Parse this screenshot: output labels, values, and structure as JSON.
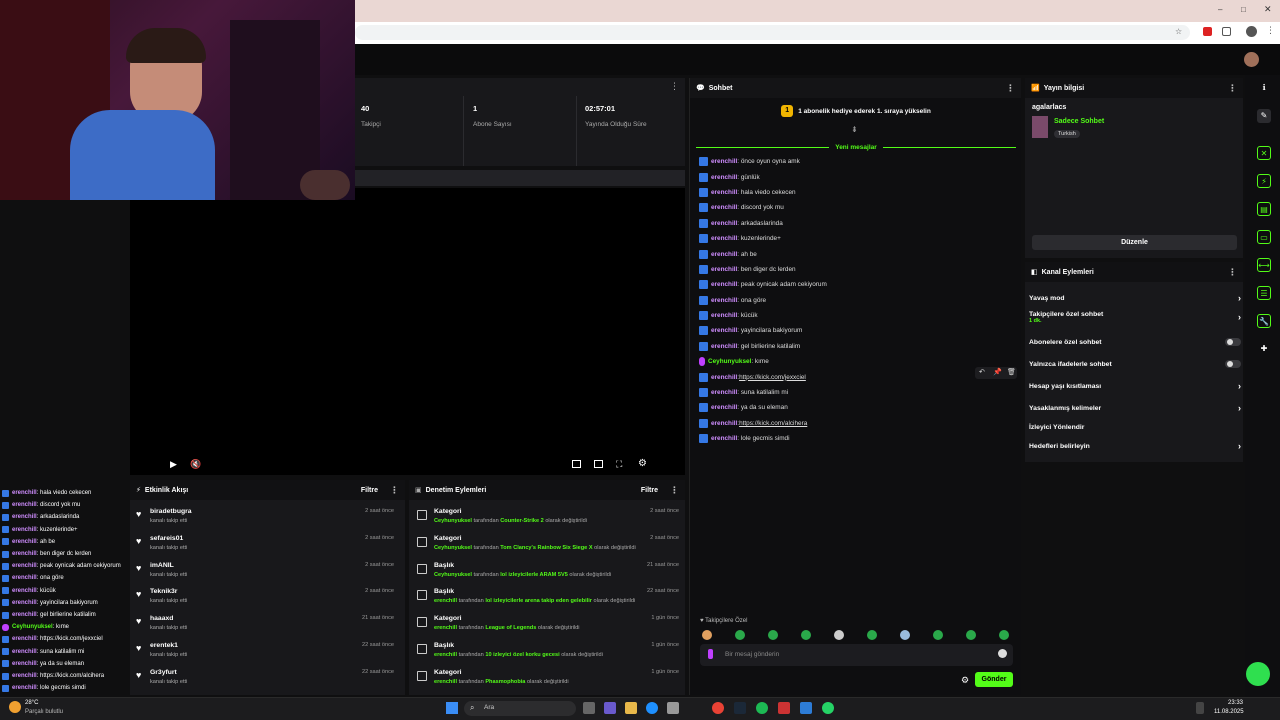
{
  "stats": [
    {
      "value": "40",
      "label": "Takipçi"
    },
    {
      "value": "1",
      "label": "Abone Sayısı"
    },
    {
      "value": "02:57:01",
      "label": "Yayında Olduğu Süre"
    }
  ],
  "activity": {
    "title": "Etkinlik Akışı",
    "filter": "Filtre",
    "items": [
      {
        "name": "biradetbugra",
        "sub": "kanalı takip etti",
        "time": "2 saat önce"
      },
      {
        "name": "sefareis01",
        "sub": "kanalı takip etti",
        "time": "2 saat önce"
      },
      {
        "name": "imANIL",
        "sub": "kanalı takip etti",
        "time": "2 saat önce"
      },
      {
        "name": "Teknik3r",
        "sub": "kanalı takip etti",
        "time": "2 saat önce"
      },
      {
        "name": "haaaxd",
        "sub": "kanalı takip etti",
        "time": "21 saat önce"
      },
      {
        "name": "erentek1",
        "sub": "kanalı takip etti",
        "time": "22 saat önce"
      },
      {
        "name": "Gr3yfurt",
        "sub": "kanalı takip etti",
        "time": "22 saat önce"
      }
    ]
  },
  "moderation": {
    "title": "Denetim Eylemleri",
    "filter": "Filtre",
    "items": [
      {
        "title": "Kategori",
        "user": "Ceyhunyuksel",
        "mid": " tarafından ",
        "val": "Counter-Strike 2",
        "end": " olarak değiştirildi",
        "time": "2 saat önce"
      },
      {
        "title": "Kategori",
        "user": "Ceyhunyuksel",
        "mid": " tarafından ",
        "val": "Tom Clancy's Rainbow Six Siege X",
        "end": " olarak değiştirildi",
        "time": "2 saat önce"
      },
      {
        "title": "Başlık",
        "user": "Ceyhunyuksel",
        "mid": " tarafından ",
        "val": "lol izleyicilerle ARAM 5V5",
        "end": " olarak değiştirildi",
        "time": "21 saat önce"
      },
      {
        "title": "Başlık",
        "user": "erenchill",
        "mid": " tarafından ",
        "val": "lol izleyicilerle arena takip eden gelebilir",
        "end": " olarak değiştirildi",
        "time": "22 saat önce"
      },
      {
        "title": "Kategori",
        "user": "erenchill",
        "mid": " tarafından ",
        "val": "League of Legends",
        "end": " olarak değiştirildi",
        "time": "1 gün önce"
      },
      {
        "title": "Başlık",
        "user": "erenchill",
        "mid": " tarafından ",
        "val": "10 izleyici özel korku gecesi",
        "end": " olarak değiştirildi",
        "time": "1 gün önce"
      },
      {
        "title": "Kategori",
        "user": "erenchill",
        "mid": " tarafından ",
        "val": "Phasmophobia",
        "end": " olarak değiştirildi",
        "time": "1 gün önce"
      }
    ]
  },
  "chat": {
    "title": "Sohbet",
    "gift_banner": "1 abonelik hediye ederek 1. sıraya yükselin",
    "new_messages": "Yeni mesajlar",
    "messages": [
      {
        "user": "erenchill",
        "text": ": önce oyun oyna amk"
      },
      {
        "user": "erenchill",
        "text": ": günlük"
      },
      {
        "user": "erenchill",
        "text": ": hala viedo cekecen"
      },
      {
        "user": "erenchill",
        "text": ": discord yok mu"
      },
      {
        "user": "erenchill",
        "text": ": arkadaslarinda"
      },
      {
        "user": "erenchill",
        "text": ": kuzenlerinde+"
      },
      {
        "user": "erenchill",
        "text": ": ah be"
      },
      {
        "user": "erenchill",
        "text": ": ben diger dc lerden"
      },
      {
        "user": "erenchill",
        "text": ": peak oynicak adam cekiyorum"
      },
      {
        "user": "erenchill",
        "text": ": ona göre"
      },
      {
        "user": "erenchill",
        "text": ": kücük"
      },
      {
        "user": "erenchill",
        "text": ": yayincilara bakiyorum"
      },
      {
        "user": "erenchill",
        "text": ": gel birlierine katilalim"
      },
      {
        "user": "Ceyhunyuksel",
        "text": ": kıme",
        "mod": true
      },
      {
        "user": "erenchill",
        "text": ": ",
        "link": "https://kick.com/jexxciel"
      },
      {
        "user": "erenchill",
        "text": ": suna katilalim mi"
      },
      {
        "user": "erenchill",
        "text": ": ya da su eleman"
      },
      {
        "user": "erenchill",
        "text": ": ",
        "link": "https://kick.com/alcihera"
      },
      {
        "user": "erenchill",
        "text": ": lole gecmis simdi"
      }
    ],
    "followers_only": "Takipçilere Özel",
    "input_placeholder": "Bir mesaj gönderin",
    "send": "Gönder"
  },
  "stream_info": {
    "title": "Yayın bilgisi",
    "stream_title": "agalarlacs",
    "mode": "Sadece Sohbet",
    "tag": "Turkish",
    "edit": "Düzenle"
  },
  "channel_actions": {
    "title": "Kanal Eylemleri",
    "items": [
      {
        "label": "Yavaş mod",
        "type": "chev"
      },
      {
        "label": "Takipçilere özel sohbet",
        "sub": "1 dk.",
        "type": "chev"
      },
      {
        "label": "Abonelere özel sohbet",
        "type": "toggle"
      },
      {
        "label": "Yalnızca ifadelerle sohbet",
        "type": "toggle"
      },
      {
        "label": "Hesap yaşı kısıtlaması",
        "type": "chev"
      },
      {
        "label": "Yasaklanmış kelimeler",
        "type": "chev"
      },
      {
        "label": "İzleyici Yönlendir",
        "type": "none"
      },
      {
        "label": "Hedefleri belirleyin",
        "type": "chev"
      }
    ]
  },
  "side_chat": [
    {
      "user": "erenchill",
      "text": " : hala viedo cekecen"
    },
    {
      "user": "erenchill",
      "text": " : discord yok mu"
    },
    {
      "user": "erenchill",
      "text": " : arkadaslarinda"
    },
    {
      "user": "erenchill",
      "text": " : kuzenlerinde+"
    },
    {
      "user": "erenchill",
      "text": " : ah be"
    },
    {
      "user": "erenchill",
      "text": " : ben diger dc lerden"
    },
    {
      "user": "erenchill",
      "text": " : peak oynicak adam cekiyorum"
    },
    {
      "user": "erenchill",
      "text": " : ona göre"
    },
    {
      "user": "erenchill",
      "text": " : kücük"
    },
    {
      "user": "erenchill",
      "text": " : yayincilara bakiyorum"
    },
    {
      "user": "erenchill",
      "text": " : gel birlierine katilalim"
    },
    {
      "user": "Ceyhunyuksel",
      "text": " : kıme",
      "mod": true
    },
    {
      "user": "erenchill",
      "text": " : https://kick.com/jexxciel"
    },
    {
      "user": "erenchill",
      "text": " : suna katilalim mi"
    },
    {
      "user": "erenchill",
      "text": " : ya da su eleman"
    },
    {
      "user": "erenchill",
      "text": " : https://kick.com/alcihera"
    },
    {
      "user": "erenchill",
      "text": " : lole gecmis simdi"
    }
  ],
  "taskbar": {
    "weather_temp": "28°C",
    "weather_desc": "Parçalı bulutlu",
    "search": "Ara",
    "time": "23:33",
    "date": "11.08.2025"
  },
  "colors": {
    "accent": "#53fc18",
    "panel": "#18181b",
    "bg": "#0f0f10"
  }
}
